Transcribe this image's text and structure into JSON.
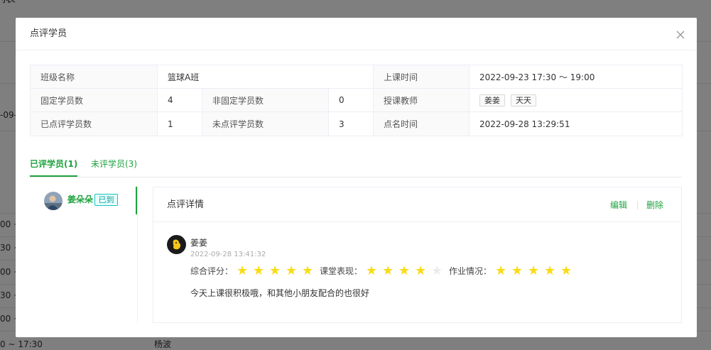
{
  "background": {
    "page_title": "列表",
    "date_fragment": "-09-",
    "time_rows": [
      "00 ~",
      "30 ~",
      "00 ~",
      "30 ~",
      "00 ~"
    ],
    "last_row_time": "0 ~ 17:30",
    "last_row_teacher": "杨波"
  },
  "modal": {
    "title": "点评学员",
    "close_icon": "close-icon",
    "info": {
      "class_name_label": "班级名称",
      "class_name": "篮球A班",
      "class_time_label": "上课时间",
      "class_time": "2022-09-23 17:30 ～ 19:00",
      "fixed_label": "固定学员数",
      "fixed_count": "4",
      "nonfixed_label": "非固定学员数",
      "nonfixed_count": "0",
      "teacher_label": "授课教师",
      "teachers": [
        "姜姜",
        "天天"
      ],
      "reviewed_label": "已点评学员数",
      "reviewed_count": "1",
      "unreviewed_label": "未点评学员数",
      "unreviewed_count": "3",
      "rollcall_label": "点名时间",
      "rollcall_time": "2022-09-28 13:29:51"
    },
    "tabs": [
      {
        "label": "已评学员(1)",
        "active": true
      },
      {
        "label": "未评学员(3)",
        "active": false
      }
    ],
    "students": [
      {
        "name": "姜朵朵",
        "status": "已到",
        "avatar": "student-avatar"
      }
    ],
    "detail": {
      "title": "点评详情",
      "edit_label": "编辑",
      "delete_label": "删除",
      "comment": {
        "author": "姜姜",
        "avatar": "teacher-avatar",
        "time": "2022-09-28 13:41:32",
        "ratings": [
          {
            "label": "综合评分：",
            "value": 5,
            "max": 5
          },
          {
            "label": "课堂表现：",
            "value": 4,
            "max": 5
          },
          {
            "label": "作业情况：",
            "value": 5,
            "max": 5
          }
        ],
        "text": "今天上课很积极哦，和其他小朋友配合的也很好"
      }
    }
  },
  "colors": {
    "accent": "#1fa33f",
    "star_on": "#fadb14",
    "star_off": "#ebebeb",
    "status_tag": "#13c2c2"
  }
}
